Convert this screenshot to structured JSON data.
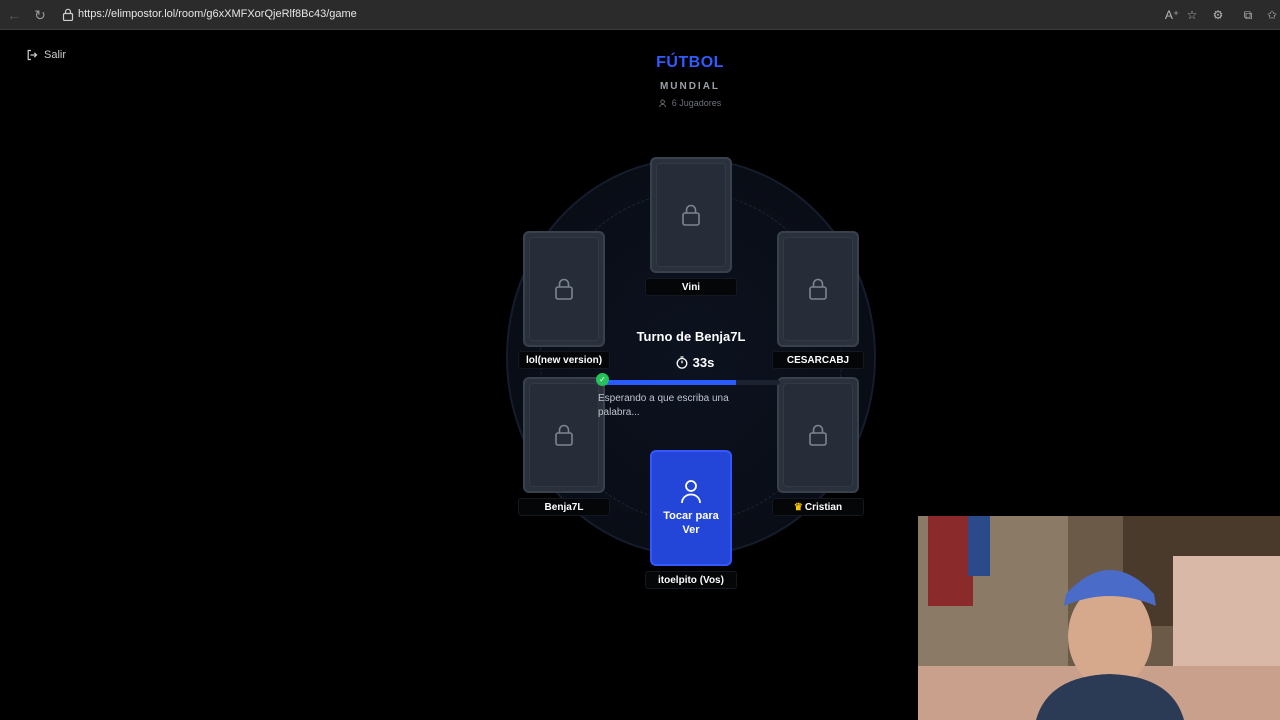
{
  "browser": {
    "url": "https://elimpostor.lol/room/g6xXMFXorQjeRlf8Bc43/game"
  },
  "page": {
    "exit_label": "Salir",
    "category": "FÚTBOL",
    "subcategory": "MUNDIAL",
    "players_count": "6 Jugadores",
    "turn_title": "Turno de Benja7L",
    "timer": "33s",
    "turn_progress_percent": 75,
    "waiting_text": "Esperando a que escriba una palabra...",
    "my_card_label": "Tocar para Ver",
    "players": [
      {
        "name": "Vini"
      },
      {
        "name": "lol(new version)"
      },
      {
        "name": "CESARCABJ"
      },
      {
        "name": "Benja7L"
      },
      {
        "name": "Cristian",
        "host": true
      },
      {
        "name": "itoelpito (Vos)",
        "me": true
      }
    ]
  },
  "colors": {
    "accent": "#2f5bff",
    "card_active": "#2346d8",
    "check": "#25c25a",
    "crown": "#f5c400"
  }
}
